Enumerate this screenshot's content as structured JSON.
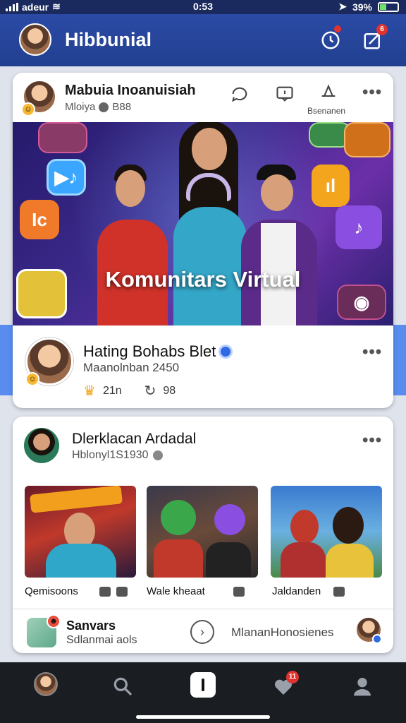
{
  "status_bar": {
    "carrier": "adeur",
    "time": "0:53",
    "battery": "39%"
  },
  "header": {
    "title": "Hibbunial",
    "notif_badge": "",
    "compose_badge": "6"
  },
  "post1": {
    "author": "Mabuia Inoanuisiah",
    "meta": "Mloiya",
    "meta_num": "B88",
    "action_label": "Bsenanen",
    "banner_text": "Komunitars Virtual",
    "sub_author": "Hating Bohabs Blet",
    "sub_meta": "Maanolnban 2450",
    "likes": "21n",
    "shares": "98"
  },
  "post2": {
    "author": "Dlerklacan Ardadal",
    "meta": "Hblonyl1S1930",
    "thumbs": [
      {
        "label": "Qemisoons"
      },
      {
        "label": "Wale kheaat"
      },
      {
        "label": "Jaldanden"
      }
    ],
    "footer_title": "Sanvars",
    "footer_sub": "Sdlanmai aols",
    "footer_link": "MlananHonosienes"
  },
  "nav": {
    "likes_badge": "11"
  },
  "colors": {
    "header": "#22408f",
    "accent": "#2d6ae3",
    "badge": "#e0332f",
    "navbar": "#1a1d22"
  }
}
